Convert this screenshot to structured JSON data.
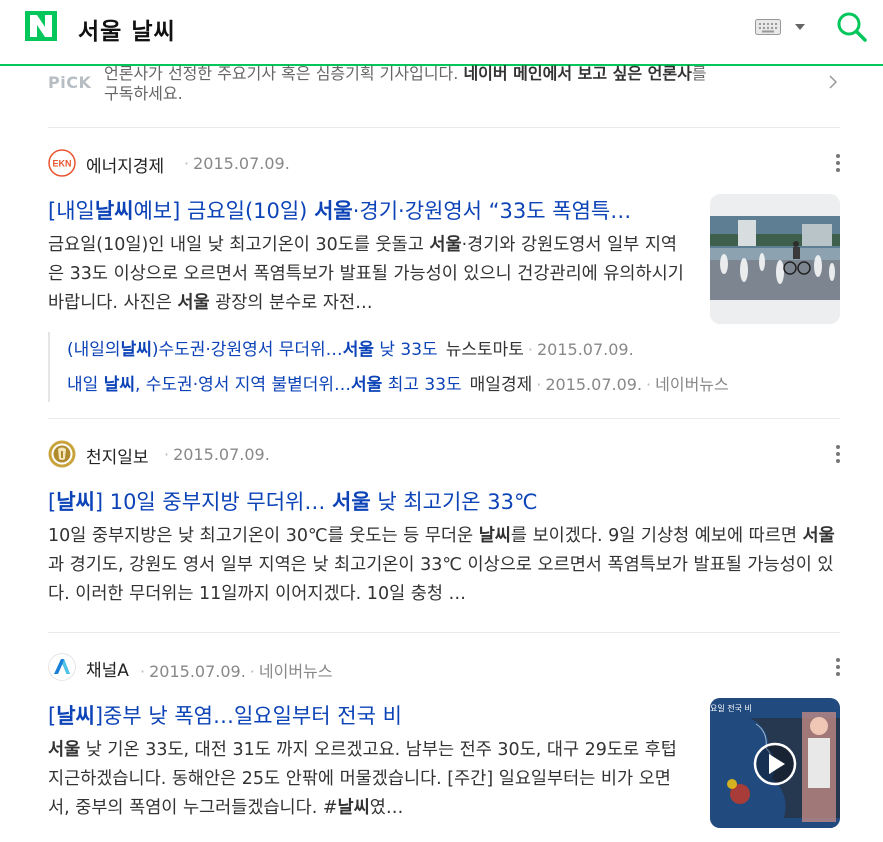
{
  "header": {
    "query": "서울 날씨"
  },
  "pick": {
    "badge": "PiCK",
    "line1_pre": "언론사가 선정한 주요기사 혹은 심층기획 기사입니다. ",
    "line1_bold": "네이버 메인에서 보고 싶은 언론사",
    "line1_post": "를",
    "line2": "구독하세요."
  },
  "articles": [
    {
      "source": "에너지경제",
      "logo_text": "EKN",
      "date": "2015.07.09.",
      "title": [
        {
          "t": "[내일",
          "b": false
        },
        {
          "t": "날씨",
          "b": true
        },
        {
          "t": "예보] 금요일(10일) ",
          "b": false
        },
        {
          "t": "서울",
          "b": true
        },
        {
          "t": "·경기·강원영서 “33도 폭염특…",
          "b": false
        }
      ],
      "desc": [
        {
          "t": "금요일(10일)인 내일 낮 최고기온이 30도를 웃돌고 ",
          "b": false
        },
        {
          "t": "서울",
          "b": true
        },
        {
          "t": "·경기와 강원도영서 일부 지역은 33도 이상으로 오르면서 폭염특보가 발표될 가능성이 있으니 건강관리에 유의하시기 바랍니다. 사진은 ",
          "b": false
        },
        {
          "t": "서울",
          "b": true
        },
        {
          "t": " 광장의 분수로 자전…",
          "b": false
        }
      ],
      "related": [
        {
          "link": [
            {
              "t": "(내일의",
              "b": false
            },
            {
              "t": "날씨",
              "b": true
            },
            {
              "t": ")수도권·강원영서 무더위…",
              "b": false
            },
            {
              "t": "서울",
              "b": true
            },
            {
              "t": " 낮 33도",
              "b": false
            }
          ],
          "source": "뉴스토마토",
          "date": "2015.07.09.",
          "extra": ""
        },
        {
          "link": [
            {
              "t": "내일 ",
              "b": false
            },
            {
              "t": "날씨",
              "b": true
            },
            {
              "t": ", 수도권·영서 지역 불볕더위…",
              "b": false
            },
            {
              "t": "서울",
              "b": true
            },
            {
              "t": " 최고 33도",
              "b": false
            }
          ],
          "source": "매일경제",
          "date": "2015.07.09.",
          "extra": "네이버뉴스"
        }
      ]
    },
    {
      "source": "천지일보",
      "date": "2015.07.09.",
      "title": [
        {
          "t": "[",
          "b": false
        },
        {
          "t": "날씨",
          "b": true
        },
        {
          "t": "] 10일 중부지방 무더위… ",
          "b": false
        },
        {
          "t": "서울",
          "b": true
        },
        {
          "t": " 낮 최고기온 33℃",
          "b": false
        }
      ],
      "desc": [
        {
          "t": "10일 중부지방은 낮 최고기온이 30℃를 웃도는 등 무더운 ",
          "b": false
        },
        {
          "t": "날씨",
          "b": true
        },
        {
          "t": "를 보이겠다. 9일 기상청 예보에 따르면 ",
          "b": false
        },
        {
          "t": "서울",
          "b": true
        },
        {
          "t": "과 경기도, 강원도 영서 일부 지역은 낮 최고기온이 33℃ 이상으로 오르면서 폭염특보가 발표될 가능성이 있다. 이러한 무더위는 11일까지 이어지겠다. 10일 충청 …",
          "b": false
        }
      ]
    },
    {
      "source": "채널A",
      "date": "2015.07.09.",
      "extra": "네이버뉴스",
      "title": [
        {
          "t": "[",
          "b": false
        },
        {
          "t": "날씨",
          "b": true
        },
        {
          "t": "]중부 낮 폭염…일요일부터 전국 비",
          "b": false
        }
      ],
      "desc": [
        {
          "t": "서울",
          "b": true
        },
        {
          "t": " 낮 기온 33도, 대전 31도 까지 오르겠고요. 남부는 전주 30도, 대구 29도로 후텁지근하겠습니다. 동해안은 25도 안팎에 머물겠습니다. [주간] 일요일부터는 비가 오면서, 중부의 폭염이 누그러들겠습니다. #",
          "b": false
        },
        {
          "t": "날씨",
          "b": true
        },
        {
          "t": "였…",
          "b": false
        }
      ],
      "thumb_text": "요일 전국 비"
    }
  ],
  "colors": {
    "brand_green": "#03c75a",
    "link_blue": "#0c43b7"
  }
}
